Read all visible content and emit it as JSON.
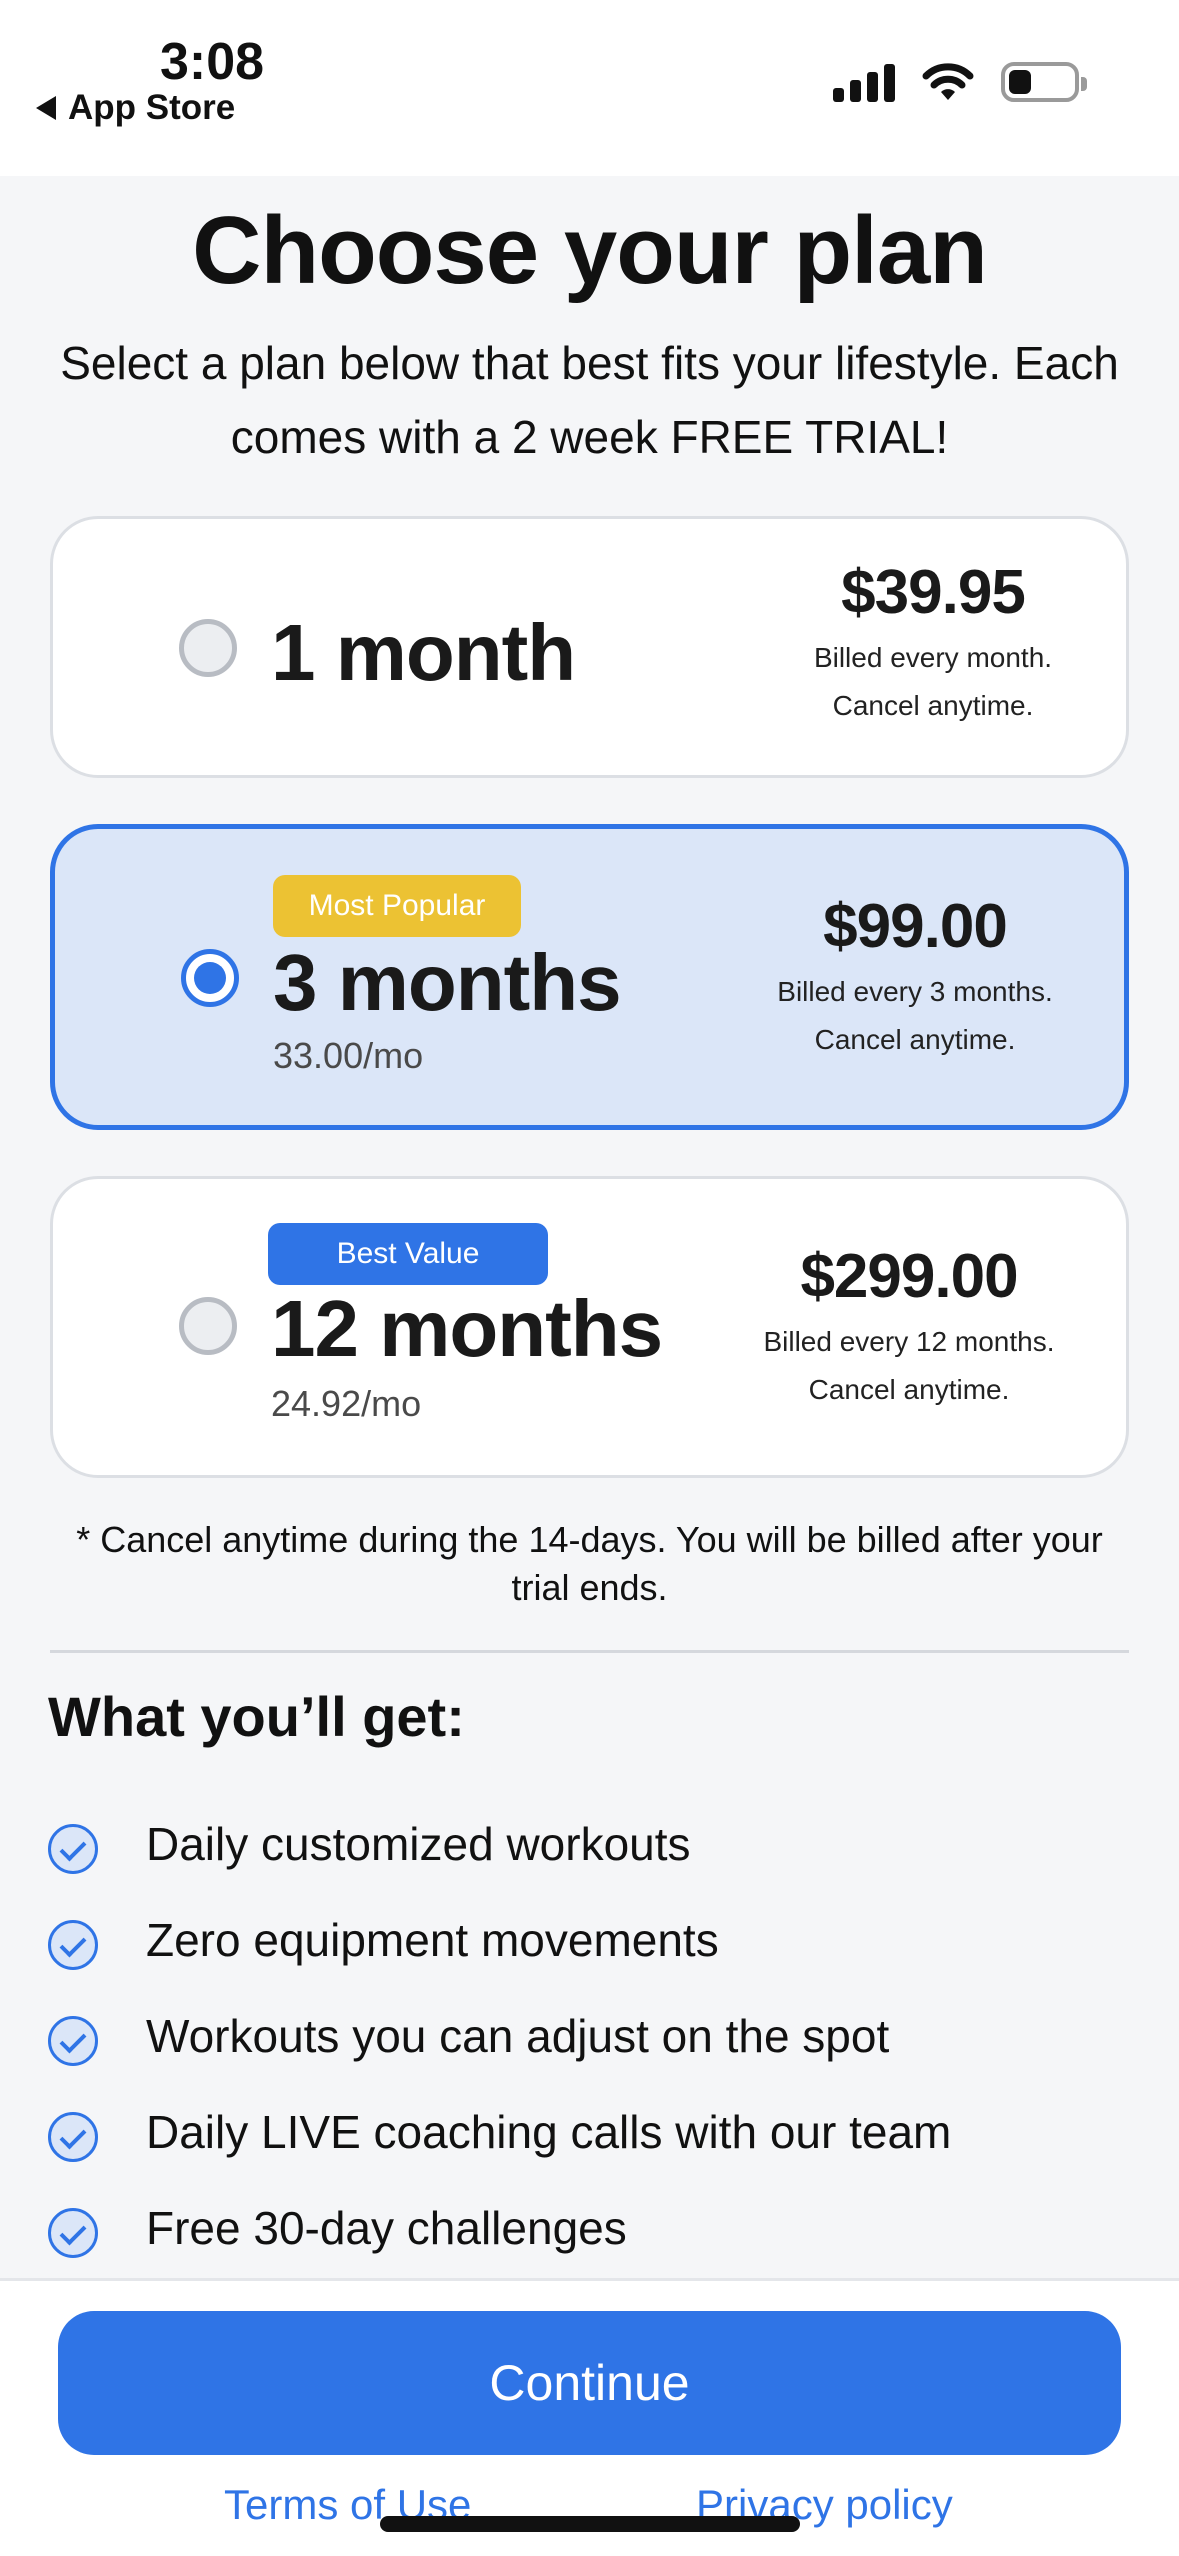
{
  "status_bar": {
    "time": "3:08",
    "back_label": "App Store",
    "icons": [
      "signal-icon",
      "wifi-icon",
      "battery-icon"
    ]
  },
  "header": {
    "title": "Choose your plan",
    "subtitle": "Select a plan below that best fits your lifestyle. Each comes with a 2 week FREE TRIAL!"
  },
  "plans": [
    {
      "name": "1 month",
      "price": "$39.95",
      "billing_line1": "Billed every month.",
      "billing_line2": "Cancel anytime.",
      "selected": false
    },
    {
      "name": "3 months",
      "badge": "Most Popular",
      "per_month": "33.00/mo",
      "price": "$99.00",
      "billing_line1": "Billed every 3 months.",
      "billing_line2": "Cancel anytime.",
      "selected": true
    },
    {
      "name": "12 months",
      "badge": "Best Value",
      "per_month": "24.92/mo",
      "price": "$299.00",
      "billing_line1": "Billed every 12 months.",
      "billing_line2": "Cancel anytime.",
      "selected": false
    }
  ],
  "disclaimer": "* Cancel anytime during the 14-days. You will be billed after your trial ends.",
  "features": {
    "heading": "What you’ll get:",
    "items": [
      "Daily customized workouts",
      "Zero equipment movements",
      "Workouts you can adjust on the spot",
      "Daily LIVE coaching calls with our team",
      "Free 30-day challenges"
    ]
  },
  "footer": {
    "continue_label": "Continue",
    "terms_label": "Terms of Use",
    "privacy_label": "Privacy policy"
  },
  "colors": {
    "accent": "#2f74e6",
    "selected_bg": "#dbe6f8",
    "badge_popular": "#ecc233",
    "badge_value": "#2f74e6",
    "page_bg": "#f5f6f8"
  }
}
